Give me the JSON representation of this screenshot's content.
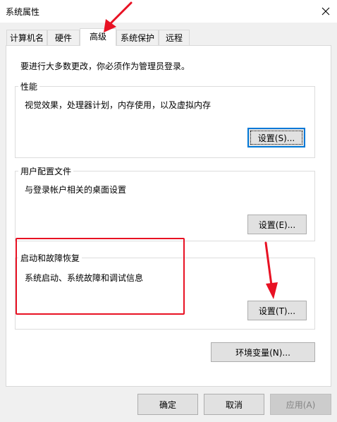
{
  "window": {
    "title": "系统属性"
  },
  "tabs": [
    {
      "label": "计算机名"
    },
    {
      "label": "硬件"
    },
    {
      "label": "高级"
    },
    {
      "label": "系统保护"
    },
    {
      "label": "远程"
    }
  ],
  "notice": "要进行大多数更改，你必须作为管理员登录。",
  "performance": {
    "legend": "性能",
    "description": "视觉效果，处理器计划，内存使用，以及虚拟内存",
    "settings_label": "设置(S)..."
  },
  "user_profiles": {
    "legend": "用户配置文件",
    "description": "与登录帐户相关的桌面设置",
    "settings_label": "设置(E)..."
  },
  "startup_recovery": {
    "legend": "启动和故障恢复",
    "description": "系统启动、系统故障和调试信息",
    "settings_label": "设置(T)..."
  },
  "env_vars_label": "环境变量(N)...",
  "footer": {
    "ok_label": "确定",
    "cancel_label": "取消",
    "apply_label": "应用(A)"
  },
  "colors": {
    "annotation_red": "#e81123",
    "focus_blue": "#0078d7"
  },
  "icons": [
    "close-icon"
  ]
}
